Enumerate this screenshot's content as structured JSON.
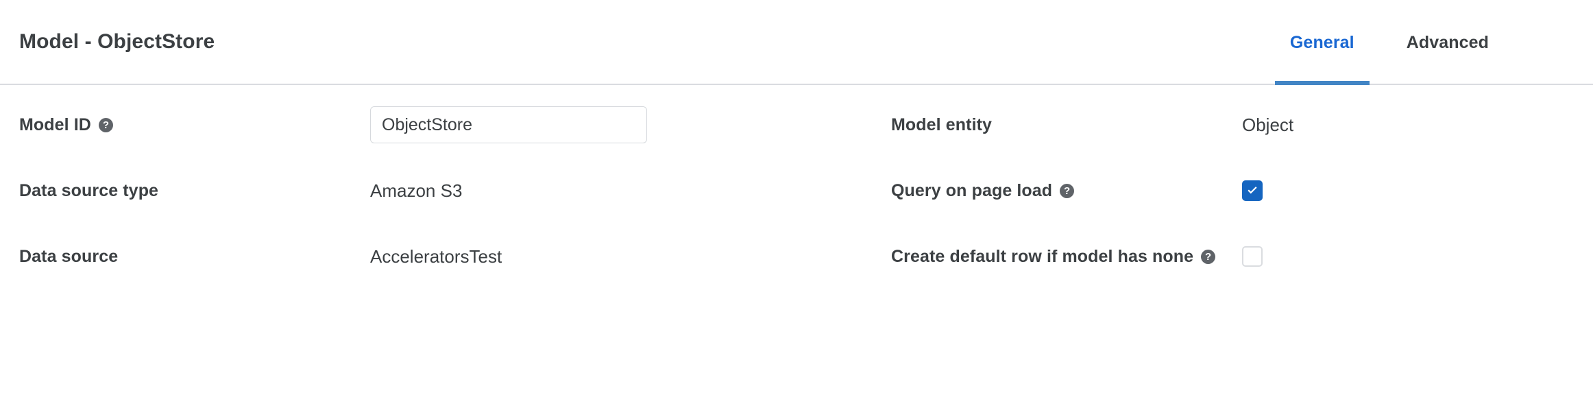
{
  "header": {
    "title": "Model - ObjectStore",
    "tabs": [
      {
        "label": "General",
        "active": true
      },
      {
        "label": "Advanced",
        "active": false
      }
    ],
    "accent_color": "#1967d2",
    "underline_color": "#4285c5"
  },
  "form": {
    "left_column": [
      {
        "label": "Model ID",
        "help_icon": "help-circle-icon",
        "control": "text-input",
        "value": "ObjectStore",
        "placeholder": ""
      },
      {
        "label": "Data source type",
        "control": "static-text",
        "value": "Amazon S3"
      },
      {
        "label": "Data source",
        "control": "static-text",
        "value": "AcceleratorsTest"
      }
    ],
    "right_column": [
      {
        "label": "Model entity",
        "control": "static-text",
        "value": "Object"
      },
      {
        "label": "Query on page load",
        "help_icon": "help-circle-icon",
        "control": "checkbox",
        "checked": true,
        "checked_color": "#1565c0"
      },
      {
        "label": "Create default row if model has none",
        "help_icon": "help-circle-icon",
        "control": "checkbox",
        "checked": false
      }
    ]
  },
  "icons": {
    "help_glyph": "?",
    "check_glyph": "check-mark-icon"
  }
}
